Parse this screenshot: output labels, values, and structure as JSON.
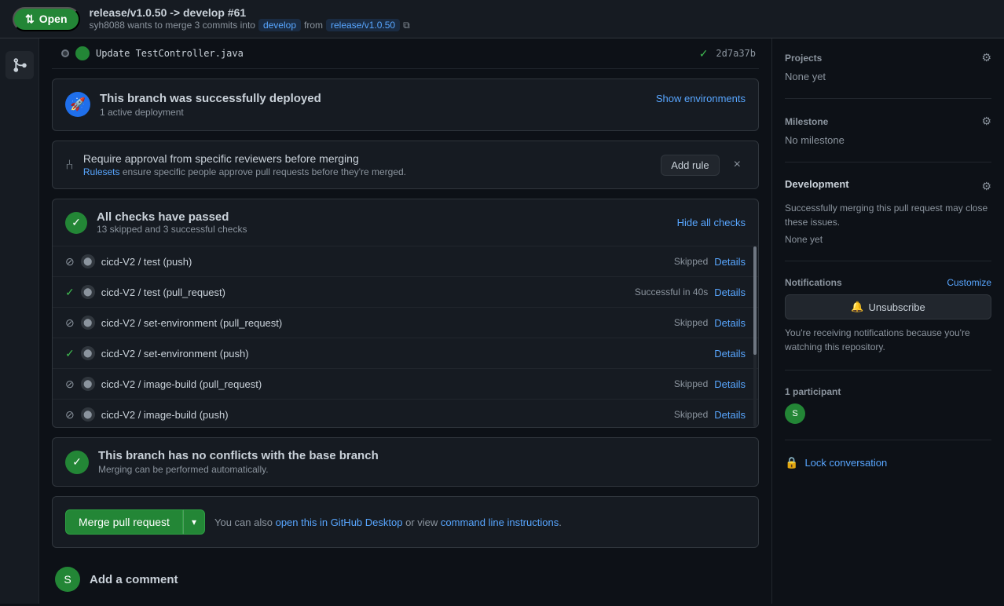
{
  "header": {
    "open_label": "Open",
    "open_icon": "⇅",
    "pr_title": "release/v1.0.50 -> develop #61",
    "pr_subtitle_prefix": "syh8088 wants to merge 3 commits into",
    "target_branch": "develop",
    "from_text": "from",
    "source_branch": "release/v1.0.50",
    "copy_icon": "⧉"
  },
  "commit_row": {
    "message": "Update TestController.java",
    "hash": "2d7a37b",
    "check_icon": "✓"
  },
  "deploy_card": {
    "icon": "🚀",
    "title": "This branch was successfully deployed",
    "subtitle": "1 active deployment",
    "action_label": "Show environments"
  },
  "ruleset_banner": {
    "icon": "⑃",
    "title": "Require approval from specific reviewers before merging",
    "desc_prefix": "Rulesets",
    "desc_suffix": "ensure specific people approve pull requests before they're merged.",
    "add_rule_label": "Add rule",
    "close_icon": "×"
  },
  "checks_card": {
    "title": "All checks have passed",
    "subtitle": "13 skipped and 3 successful checks",
    "hide_label": "Hide all checks",
    "checks": [
      {
        "name": "cicd-V2 / test (push)",
        "status": "skip",
        "badge": "Skipped",
        "has_details": true
      },
      {
        "name": "cicd-V2 / test (pull_request)",
        "status": "pass",
        "badge": "Successful in 40s",
        "has_details": true
      },
      {
        "name": "cicd-V2 / set-environment (pull_request)",
        "status": "skip",
        "badge": "Skipped",
        "has_details": true
      },
      {
        "name": "cicd-V2 / set-environment (push)",
        "status": "pass",
        "badge": "",
        "has_details": true
      },
      {
        "name": "cicd-V2 / image-build (pull_request)",
        "status": "skip",
        "badge": "Skipped",
        "has_details": true
      },
      {
        "name": "cicd-V2 / image-build (push)",
        "status": "skip",
        "badge": "Skipped",
        "has_details": true
      }
    ],
    "details_label": "Details"
  },
  "no_conflict_card": {
    "title": "This branch has no conflicts with the base branch",
    "subtitle": "Merging can be performed automatically."
  },
  "merge_area": {
    "merge_label": "Merge pull request",
    "arrow_icon": "▾",
    "desc_prefix": "You can also",
    "github_desktop_link": "open this in GitHub Desktop",
    "or_text": "or view",
    "cli_link": "command line instructions",
    "desc_suffix": "."
  },
  "add_comment": {
    "label": "Add a comment",
    "avatar_text": "S"
  },
  "sidebar": {
    "projects": {
      "title": "Projects",
      "value": "None yet",
      "gear_icon": "⚙"
    },
    "milestone": {
      "title": "Milestone",
      "value": "No milestone",
      "gear_icon": "⚙"
    },
    "development": {
      "title": "Development",
      "gear_icon": "⚙",
      "description": "Successfully merging this pull request may close these issues.",
      "none_label": "None yet"
    },
    "notifications": {
      "title": "Notifications",
      "customize_label": "Customize",
      "unsubscribe_label": "Unsubscribe",
      "unsubscribe_icon": "🔔",
      "notify_desc": "You're receiving notifications because you're watching this repository."
    },
    "participants": {
      "count_label": "1 participant",
      "avatar_text": "S"
    },
    "lock": {
      "icon": "🔒",
      "label": "Lock conversation"
    }
  }
}
